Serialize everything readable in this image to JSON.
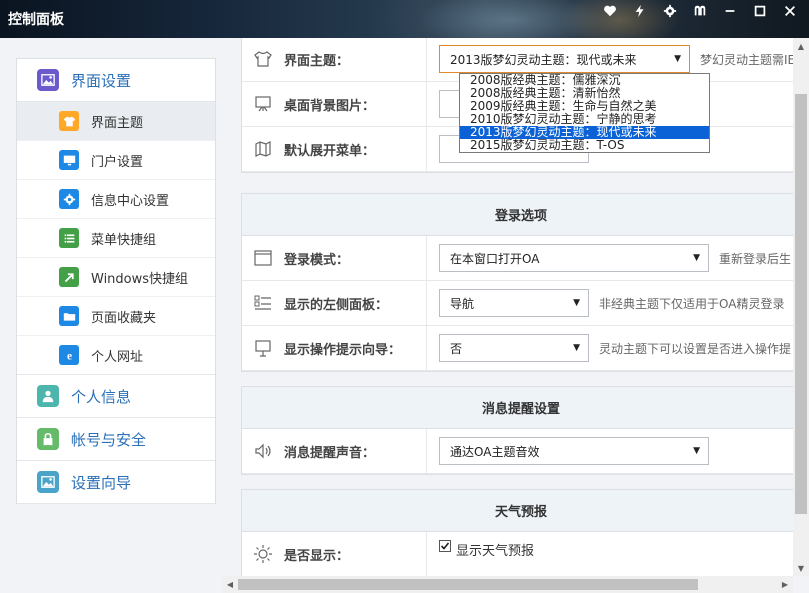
{
  "window": {
    "title": "控制面板",
    "buttons": [
      "heart-icon",
      "bolt-icon",
      "gear-icon",
      "skin-icon",
      "minimize-icon",
      "maximize-icon",
      "close-icon"
    ]
  },
  "sidebar": {
    "sections": [
      {
        "label": "界面设置",
        "icon": "picture-icon",
        "color": "#6a5acd"
      },
      {
        "label": "个人信息",
        "icon": "person-icon",
        "color": "#4db6ac"
      },
      {
        "label": "帐号与安全",
        "icon": "lock-icon",
        "color": "#66bb6a"
      },
      {
        "label": "设置向导",
        "icon": "picture-icon",
        "color": "#4aa3c8"
      }
    ],
    "items": [
      {
        "label": "界面主题",
        "icon": "shirt-icon",
        "color": "#ffa726"
      },
      {
        "label": "门户设置",
        "icon": "monitor-icon",
        "color": "#1e88e5"
      },
      {
        "label": "信息中心设置",
        "icon": "gear-icon",
        "color": "#1e88e5"
      },
      {
        "label": "菜单快捷组",
        "icon": "list-icon",
        "color": "#43a047"
      },
      {
        "label": "Windows快捷组",
        "icon": "arrow-icon",
        "color": "#43a047"
      },
      {
        "label": "页面收藏夹",
        "icon": "folder-icon",
        "color": "#1e88e5"
      },
      {
        "label": "个人网址",
        "icon": "ie-icon",
        "color": "#1e88e5"
      }
    ]
  },
  "theme_panel": {
    "rows": [
      {
        "label": "界面主题：",
        "value": "2013版梦幻灵动主题：现代或未来",
        "hint": "梦幻灵动主题需IE"
      },
      {
        "label": "桌面背景图片：",
        "value": "",
        "hint": ""
      },
      {
        "label": "默认展开菜单：",
        "value": "",
        "hint": ""
      }
    ],
    "dropdown_options": [
      "2008版经典主题：儒雅深沉",
      "2008版经典主题：清新怡然",
      "2009版经典主题：生命与自然之美",
      "2010版梦幻灵动主题：宁静的思考",
      "2013版梦幻灵动主题：现代或未来",
      "2015版梦幻灵动主题：T-OS"
    ],
    "selected_index": 4
  },
  "login_panel": {
    "title": "登录选项",
    "rows": [
      {
        "label": "登录模式：",
        "value": "在本窗口打开OA",
        "hint": "重新登录后生"
      },
      {
        "label": "显示的左侧面板：",
        "value": "导航",
        "hint": "非经典主题下仅适用于OA精灵登录"
      },
      {
        "label": "显示操作提示向导：",
        "value": "否",
        "hint": "灵动主题下可以设置是否进入操作提"
      }
    ]
  },
  "message_panel": {
    "title": "消息提醒设置",
    "rows": [
      {
        "label": "消息提醒声音：",
        "value": "通达OA主题音效"
      }
    ]
  },
  "weather_panel": {
    "title": "天气预报",
    "rows": [
      {
        "label": "是否显示：",
        "checkbox_label": "显示天气预报",
        "checked": true
      }
    ]
  }
}
